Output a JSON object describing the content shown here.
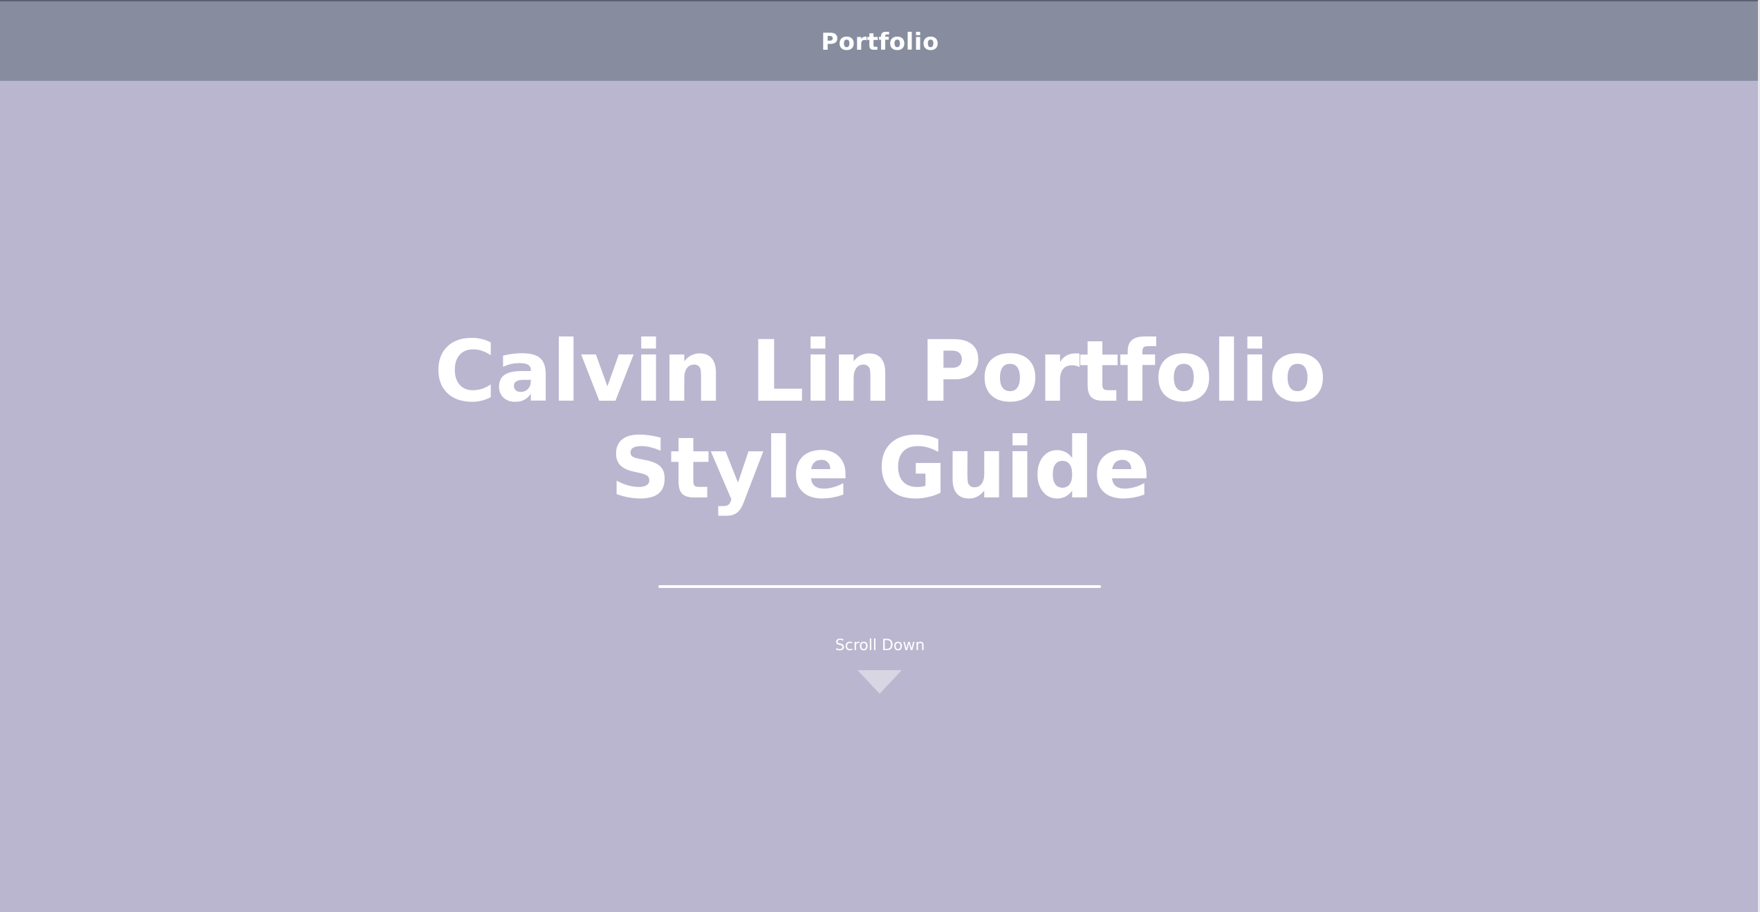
{
  "header": {
    "title": "Portfolio"
  },
  "hero": {
    "title_line1": "Calvin Lin Portfolio",
    "title_line2": "Style Guide"
  },
  "scroll": {
    "label": "Scroll Down",
    "icon": "triangle-down-icon"
  },
  "colors": {
    "header_bg": "#878d9f",
    "page_bg": "#bab6cf",
    "text": "#ffffff",
    "arrow": "#d9d6e4"
  }
}
